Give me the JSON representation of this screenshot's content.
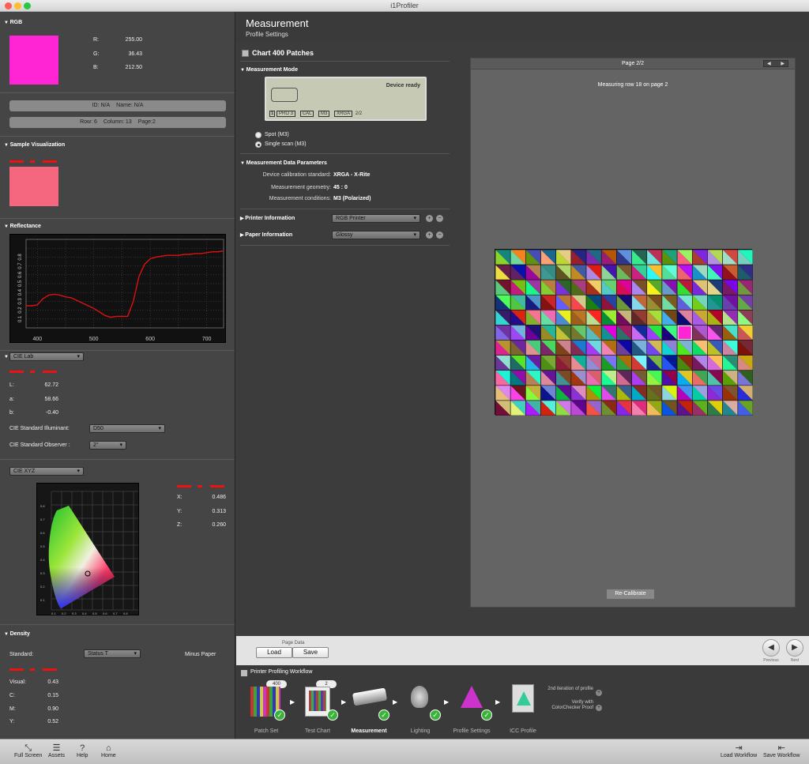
{
  "window": {
    "title": "i1Profiler",
    "colors": {
      "close": "#fd5f57",
      "min": "#febc2e",
      "max": "#28c840"
    }
  },
  "left": {
    "rgb": {
      "heading": "RGB",
      "swatch": "#ff24d4",
      "r_label": "R:",
      "r": "255.00",
      "g_label": "G:",
      "g": "36.43",
      "b_label": "B:",
      "b": "212.50"
    },
    "id_pill": {
      "id": "ID: N/A",
      "name": "Name: N/A"
    },
    "pos_pill": {
      "row": "Row: 6",
      "column": "Column: 13",
      "page": "Page:2"
    },
    "sample": {
      "heading": "Sample Visualization",
      "swatch": "#f5677f"
    },
    "reflectance": {
      "heading": "Reflectance"
    },
    "lab": {
      "dropdown": "CIE Lab",
      "L_label": "L:",
      "L": "62.72",
      "a_label": "a:",
      "a": "58.66",
      "b_label": "b:",
      "b": "-0.40",
      "illuminant_label": "CIE Standard Illuminant:",
      "illuminant": "D50",
      "observer_label": "CIE Standard Observer :",
      "observer": "2°"
    },
    "xyz": {
      "dropdown": "CIE XYZ",
      "X_label": "X:",
      "X": "0.486",
      "Y_label": "Y:",
      "Y": "0.313",
      "Z_label": "Z:",
      "Z": "0.260"
    },
    "density": {
      "heading": "Density",
      "standard_label": "Standard:",
      "standard": "Status T",
      "minus_paper": "Minus Paper",
      "visual_label": "Visual:",
      "visual": "0.43",
      "C_label": "C:",
      "C": "0.15",
      "M_label": "M:",
      "M": "0.90",
      "Y_label": "Y:",
      "Y": "0.52"
    }
  },
  "chart_data": {
    "type": "line",
    "title": "",
    "xlabel": "",
    "ylabel": "",
    "xlim": [
      380,
      730
    ],
    "ylim": [
      0,
      1
    ],
    "xticks": [
      "400",
      "500",
      "600",
      "700"
    ],
    "yticks": [
      "0.1",
      "0.2",
      "0.3",
      "0.4",
      "0.5",
      "0.6",
      "0.7",
      "0.8"
    ],
    "grid": true,
    "series": [
      {
        "color": "#dd1111",
        "x": [
          380,
          390,
          400,
          410,
          420,
          430,
          440,
          450,
          460,
          470,
          480,
          490,
          500,
          510,
          520,
          530,
          540,
          550,
          560,
          570,
          580,
          590,
          600,
          610,
          620,
          630,
          640,
          650,
          660,
          670,
          680,
          690,
          700,
          710,
          720,
          730
        ],
        "values": [
          0.25,
          0.25,
          0.26,
          0.33,
          0.37,
          0.38,
          0.37,
          0.35,
          0.34,
          0.31,
          0.28,
          0.25,
          0.22,
          0.18,
          0.14,
          0.12,
          0.13,
          0.13,
          0.13,
          0.3,
          0.58,
          0.72,
          0.78,
          0.8,
          0.81,
          0.82,
          0.82,
          0.82,
          0.83,
          0.83,
          0.84,
          0.84,
          0.85,
          0.86,
          0.86,
          0.87
        ]
      }
    ]
  },
  "main": {
    "title": "Measurement",
    "subtitle": "Profile Settings",
    "chart_heading": "Chart 400 Patches",
    "measurement_mode": "Measurement Mode",
    "device": {
      "status": "Device ready",
      "model": "PRO 3",
      "cal": "CAL",
      "mode": "M3",
      "xrga": "XRGA",
      "page": "2/2",
      "slot": "1"
    },
    "spot": "Spot (M3)",
    "single": "Single scan (M3)",
    "params": {
      "heading": "Measurement Data Parameters",
      "calib_label": "Device calibration standard:",
      "calib": "XRGA - X-Rite",
      "geom_label": "Measurement geometry:",
      "geom": "45 : 0",
      "cond_label": "Measurement conditions:",
      "cond": "M3 (Polarized)"
    },
    "printer": {
      "label": "Printer Information",
      "value": "RGB Printer"
    },
    "paper": {
      "label": "Paper Information",
      "value": "Glossy"
    },
    "preview": {
      "page": "Page 2/2",
      "status": "Measuring row 18 on page 2",
      "recalibrate": "Re-Calibrate"
    }
  },
  "bottom": {
    "page_data": "Page Data",
    "load": "Load",
    "save": "Save",
    "previous": "Previous",
    "next": "Next",
    "workflow_title": "Printer Profiling Workflow",
    "steps": [
      {
        "label": "Patch Set",
        "badge": "400"
      },
      {
        "label": "Test Chart",
        "badge": "2"
      },
      {
        "label": "Measurement"
      },
      {
        "label": "Lighting"
      },
      {
        "label": "Profile Settings"
      },
      {
        "label": "ICC Profile"
      }
    ],
    "iteration": "2nd iteration of profile",
    "verify": "Verify with ColorChecker Proof"
  },
  "statusbar": {
    "fullscreen": "Full Screen",
    "assets": "Assets",
    "help": "Help",
    "home": "Home",
    "load_workflow": "Load Workflow",
    "save_workflow": "Save Workflow"
  }
}
